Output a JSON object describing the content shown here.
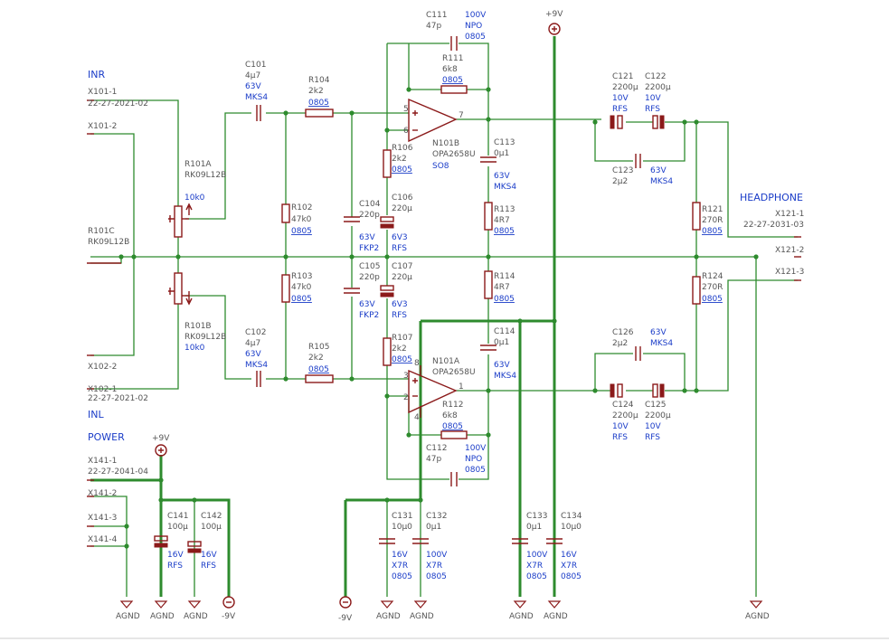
{
  "titles": {
    "inr": "INR",
    "inl": "INL",
    "headphone": "HEADPHONE",
    "power": "POWER"
  },
  "connectors": {
    "x101_1": {
      "name": "X101-1",
      "part": "22-27-2021-02"
    },
    "x101_2": {
      "name": "X101-2"
    },
    "x102_2": {
      "name": "X102-2"
    },
    "x102_1": {
      "name": "X102-1",
      "part": "22-27-2021-02"
    },
    "x121_1": {
      "name": "X121-1",
      "part": "22-27-2031-03"
    },
    "x121_2": {
      "name": "X121-2"
    },
    "x121_3": {
      "name": "X121-3"
    },
    "x141_1": {
      "name": "X141-1",
      "part": "22-27-2041-04"
    },
    "x141_2": {
      "name": "X141-2"
    },
    "x141_3": {
      "name": "X141-3"
    },
    "x141_4": {
      "name": "X141-4"
    }
  },
  "pots": {
    "r101a": {
      "name": "R101A",
      "part": "RK09L12B",
      "value": "10k0"
    },
    "r101b": {
      "name": "R101B",
      "part": "RK09L12B",
      "value": "10k0"
    },
    "r101c": {
      "name": "R101C",
      "part": "RK09L12B"
    }
  },
  "components": {
    "c101": {
      "name": "C101",
      "value": "4µ7",
      "v": "63V",
      "t": "MKS4"
    },
    "c102": {
      "name": "C102",
      "value": "4µ7",
      "v": "63V",
      "t": "MKS4"
    },
    "r104": {
      "name": "R104",
      "value": "2k2",
      "pkg": "0805"
    },
    "r105": {
      "name": "R105",
      "value": "2k2",
      "pkg": "0805"
    },
    "r102": {
      "name": "R102",
      "value": "47k0",
      "pkg": "0805"
    },
    "r103": {
      "name": "R103",
      "value": "47k0",
      "pkg": "0805"
    },
    "c104": {
      "name": "C104",
      "value": "220p",
      "v": "63V",
      "t": "FKP2"
    },
    "c105": {
      "name": "C105",
      "value": "220p",
      "v": "63V",
      "t": "FKP2"
    },
    "c106": {
      "name": "C106",
      "value": "220µ",
      "v": "6V3",
      "t": "RFS"
    },
    "c107": {
      "name": "C107",
      "value": "220µ",
      "v": "6V3",
      "t": "RFS"
    },
    "r106": {
      "name": "R106",
      "value": "2k2",
      "pkg": "0805"
    },
    "r107": {
      "name": "R107",
      "value": "2k2",
      "pkg": "0805"
    },
    "c111": {
      "name": "C111",
      "value": "47p",
      "v": "100V",
      "t": "NPO",
      "pkg": "0805"
    },
    "c112": {
      "name": "C112",
      "value": "47p",
      "v": "100V",
      "t": "NPO",
      "pkg": "0805"
    },
    "r111": {
      "name": "R111",
      "value": "6k8",
      "pkg": "0805"
    },
    "r112": {
      "name": "R112",
      "value": "6k8",
      "pkg": "0805"
    },
    "c113": {
      "name": "C113",
      "value": "0µ1",
      "v": "63V",
      "t": "MKS4"
    },
    "c114": {
      "name": "C114",
      "value": "0µ1",
      "v": "63V",
      "t": "MKS4"
    },
    "r113": {
      "name": "R113",
      "value": "4R7",
      "pkg": "0805"
    },
    "r114": {
      "name": "R114",
      "value": "4R7",
      "pkg": "0805"
    },
    "c121": {
      "name": "C121",
      "value": "2200µ",
      "v": "10V",
      "t": "RFS"
    },
    "c122": {
      "name": "C122",
      "value": "2200µ",
      "v": "10V",
      "t": "RFS"
    },
    "c124": {
      "name": "C124",
      "value": "2200µ",
      "v": "10V",
      "t": "RFS"
    },
    "c125": {
      "name": "C125",
      "value": "2200µ",
      "v": "10V",
      "t": "RFS"
    },
    "c123": {
      "name": "C123",
      "value": "2µ2",
      "v": "63V",
      "t": "MKS4"
    },
    "c126": {
      "name": "C126",
      "value": "2µ2",
      "v": "63V",
      "t": "MKS4"
    },
    "r121": {
      "name": "R121",
      "value": "270R",
      "pkg": "0805"
    },
    "r124": {
      "name": "R124",
      "value": "270R",
      "pkg": "0805"
    },
    "c131": {
      "name": "C131",
      "value": "10µ0",
      "v": "16V",
      "t": "X7R",
      "pkg": "0805"
    },
    "c132": {
      "name": "C132",
      "value": "0µ1",
      "v": "100V",
      "t": "X7R",
      "pkg": "0805"
    },
    "c133": {
      "name": "C133",
      "value": "0µ1",
      "v": "100V",
      "t": "X7R",
      "pkg": "0805"
    },
    "c134": {
      "name": "C134",
      "value": "10µ0",
      "v": "16V",
      "t": "X7R",
      "pkg": "0805"
    },
    "c141": {
      "name": "C141",
      "value": "100µ",
      "v": "16V",
      "t": "RFS"
    },
    "c142": {
      "name": "C142",
      "value": "100µ",
      "v": "16V",
      "t": "RFS"
    }
  },
  "opamps": {
    "n101b": {
      "name": "N101B",
      "part": "OPA2658U",
      "pkg": "SO8",
      "pin_in_p": "5",
      "pin_in_n": "6",
      "pin_out": "7"
    },
    "n101a": {
      "name": "N101A",
      "part": "OPA2658U",
      "pin_in_p": "3",
      "pin_in_n": "2",
      "pin_out": "1",
      "pin_vp": "8",
      "pin_vn": "4"
    }
  },
  "supplies": {
    "p9": "+9V",
    "m9": "-9V",
    "agnd": "AGND"
  }
}
